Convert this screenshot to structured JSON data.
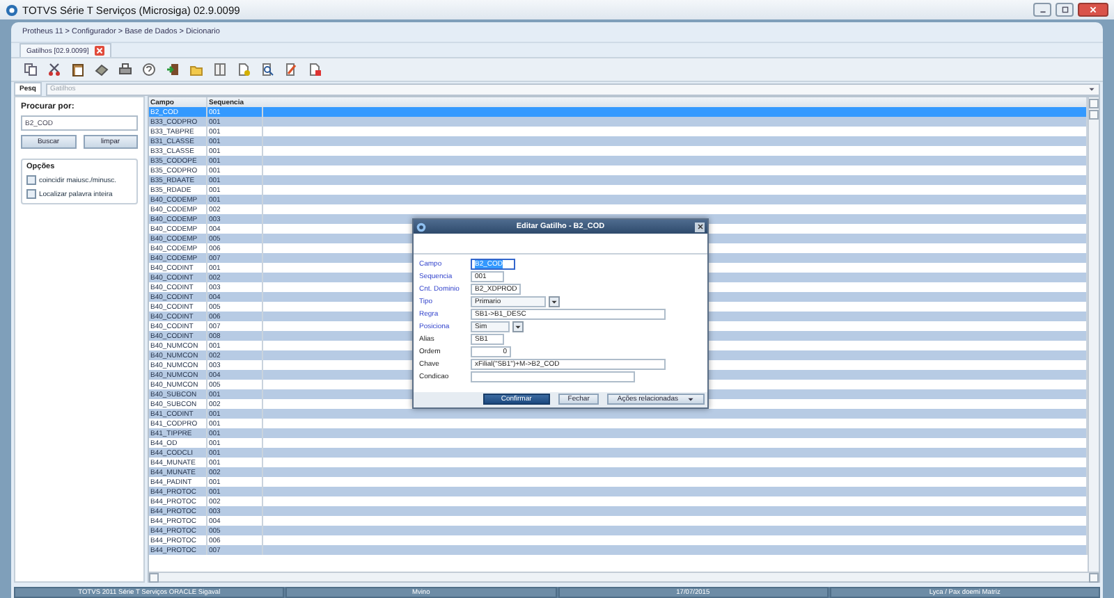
{
  "window": {
    "title": "TOTVS Série T Serviços (Microsiga) 02.9.0099"
  },
  "breadcrumb": "Protheus 11 > Configurador > Base de Dados > Dicionario",
  "document_tab": {
    "label": "Gatilhos [02.9.0099]"
  },
  "search_tabs": [
    {
      "label": "Pesq",
      "selected": true
    }
  ],
  "filter_field": {
    "value": "Gatilhos",
    "disabled": true
  },
  "search_panel": {
    "label": "Procurar por:",
    "value": "B2_COD",
    "buttons": [
      "Buscar",
      "limpar"
    ],
    "options_title": "Opções",
    "options": [
      {
        "label": "coincidir maiusc./minusc.",
        "checked": false
      },
      {
        "label": "Localizar palavra inteira",
        "checked": false
      }
    ]
  },
  "table": {
    "columns": [
      "Campo",
      "Sequencia"
    ],
    "rows": [
      {
        "cells": [
          "B2_COD",
          "001"
        ],
        "selected": true
      },
      {
        "cells": [
          "B33_CODPRO",
          "001"
        ],
        "selected": false
      },
      {
        "cells": [
          "B33_TABPRE",
          "001"
        ],
        "selected": false
      },
      {
        "cells": [
          "B31_CLASSE",
          "001"
        ],
        "selected": false
      },
      {
        "cells": [
          "B33_CLASSE",
          "001"
        ],
        "selected": false
      },
      {
        "cells": [
          "B35_CODOPE",
          "001"
        ],
        "selected": false
      },
      {
        "cells": [
          "B35_CODPRO",
          "001"
        ],
        "selected": false
      },
      {
        "cells": [
          "B35_RDAATE",
          "001"
        ],
        "selected": false
      },
      {
        "cells": [
          "B35_RDADE",
          "001"
        ],
        "selected": false
      },
      {
        "cells": [
          "B40_CODEMP",
          "001"
        ],
        "selected": false
      },
      {
        "cells": [
          "B40_CODEMP",
          "002"
        ],
        "selected": false
      },
      {
        "cells": [
          "B40_CODEMP",
          "003"
        ],
        "selected": false
      },
      {
        "cells": [
          "B40_CODEMP",
          "004"
        ],
        "selected": false
      },
      {
        "cells": [
          "B40_CODEMP",
          "005"
        ],
        "selected": false
      },
      {
        "cells": [
          "B40_CODEMP",
          "006"
        ],
        "selected": false
      },
      {
        "cells": [
          "B40_CODEMP",
          "007"
        ],
        "selected": false
      },
      {
        "cells": [
          "B40_CODINT",
          "001"
        ],
        "selected": false
      },
      {
        "cells": [
          "B40_CODINT",
          "002"
        ],
        "selected": false
      },
      {
        "cells": [
          "B40_CODINT",
          "003"
        ],
        "selected": false
      },
      {
        "cells": [
          "B40_CODINT",
          "004"
        ],
        "selected": false
      },
      {
        "cells": [
          "B40_CODINT",
          "005"
        ],
        "selected": false
      },
      {
        "cells": [
          "B40_CODINT",
          "006"
        ],
        "selected": false
      },
      {
        "cells": [
          "B40_CODINT",
          "007"
        ],
        "selected": false
      },
      {
        "cells": [
          "B40_CODINT",
          "008"
        ],
        "selected": false
      },
      {
        "cells": [
          "B40_NUMCON",
          "001"
        ],
        "selected": false
      },
      {
        "cells": [
          "B40_NUMCON",
          "002"
        ],
        "selected": false
      },
      {
        "cells": [
          "B40_NUMCON",
          "003"
        ],
        "selected": false
      },
      {
        "cells": [
          "B40_NUMCON",
          "004"
        ],
        "selected": false
      },
      {
        "cells": [
          "B40_NUMCON",
          "005"
        ],
        "selected": false
      },
      {
        "cells": [
          "B40_SUBCON",
          "001"
        ],
        "selected": false
      },
      {
        "cells": [
          "B40_SUBCON",
          "002"
        ],
        "selected": false
      },
      {
        "cells": [
          "B41_CODINT",
          "001"
        ],
        "selected": false
      },
      {
        "cells": [
          "B41_CODPRO",
          "001"
        ],
        "selected": false
      },
      {
        "cells": [
          "B41_TIPPRE",
          "001"
        ],
        "selected": false
      },
      {
        "cells": [
          "B44_OD",
          "001"
        ],
        "selected": false
      },
      {
        "cells": [
          "B44_CODCLI",
          "001"
        ],
        "selected": false
      },
      {
        "cells": [
          "B44_MUNATE",
          "001"
        ],
        "selected": false
      },
      {
        "cells": [
          "B44_MUNATE",
          "002"
        ],
        "selected": false
      },
      {
        "cells": [
          "B44_PADINT",
          "001"
        ],
        "selected": false
      },
      {
        "cells": [
          "B44_PROTOC",
          "001"
        ],
        "selected": false
      },
      {
        "cells": [
          "B44_PROTOC",
          "002"
        ],
        "selected": false
      },
      {
        "cells": [
          "B44_PROTOC",
          "003"
        ],
        "selected": false
      },
      {
        "cells": [
          "B44_PROTOC",
          "004"
        ],
        "selected": false
      },
      {
        "cells": [
          "B44_PROTOC",
          "005"
        ],
        "selected": false
      },
      {
        "cells": [
          "B44_PROTOC",
          "006"
        ],
        "selected": false
      },
      {
        "cells": [
          "B44_PROTOC",
          "007"
        ],
        "selected": false
      }
    ]
  },
  "dialog": {
    "title": "Editar Gatilho - B2_COD",
    "fields": [
      {
        "label": "Campo",
        "value": "B2_COD",
        "kind": "text",
        "required": true,
        "focused": true
      },
      {
        "label": "Sequencia",
        "value": "001",
        "kind": "text",
        "required": true,
        "focused": false
      },
      {
        "label": "Cnt. Dominio",
        "value": "B2_XDPROD",
        "kind": "text",
        "required": true,
        "focused": false
      },
      {
        "label": "Tipo",
        "value": "Primario",
        "kind": "select",
        "required": true,
        "focused": false
      },
      {
        "label": "Regra",
        "value": "SB1->B1_DESC",
        "kind": "text",
        "required": true,
        "focused": false
      },
      {
        "label": "Posiciona",
        "value": "Sim",
        "kind": "select",
        "required": true,
        "focused": false
      },
      {
        "label": "Alias",
        "value": "SB1",
        "kind": "text",
        "required": false,
        "focused": false
      },
      {
        "label": "Ordem",
        "value": "0",
        "kind": "number",
        "required": false,
        "focused": false
      },
      {
        "label": "Chave",
        "value": "xFilial(\"SB1\")+M->B2_COD",
        "kind": "text",
        "required": false,
        "focused": false
      },
      {
        "label": "Condicao",
        "kind": "text",
        "required": false,
        "focused": false
      }
    ],
    "buttons": [
      {
        "label": "Confirmar",
        "kind": "primary"
      },
      {
        "label": "Fechar",
        "kind": "plain"
      },
      {
        "label": "Ações relacionadas",
        "kind": "menu"
      }
    ]
  },
  "status_bar": [
    "TOTVS 2011 Série T Serviços ORACLE Sigaval",
    "Mvino",
    "17/07/2015",
    "Lyca / Pax doemi Matriz"
  ]
}
